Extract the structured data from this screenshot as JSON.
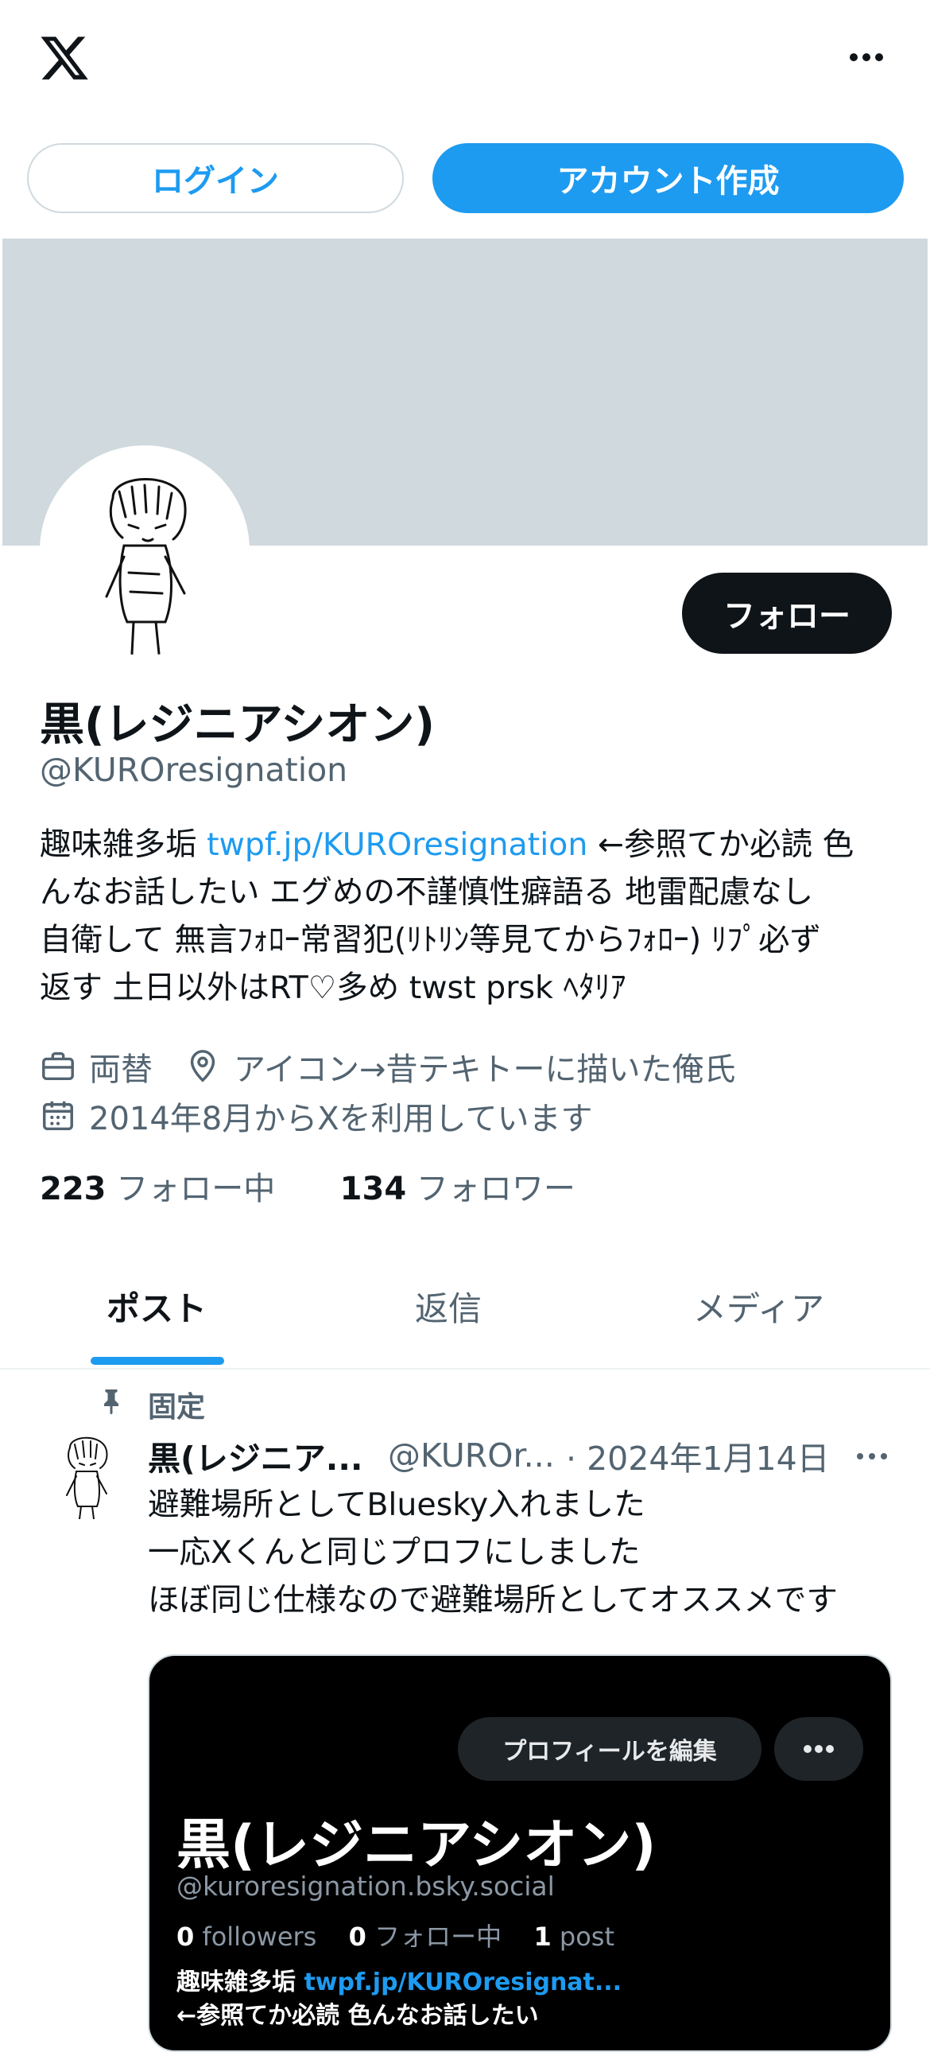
{
  "topbar": {
    "logo_icon": "x-logo-icon",
    "more_icon": "more-horizontal-icon",
    "login_label": "ログイン",
    "signup_label": "アカウント作成"
  },
  "profile": {
    "follow_label": "フォロー",
    "name": "黒(レジニアシオン)",
    "handle": "@KUROresignation",
    "bio_lines": [
      {
        "pre": "趣味雑多垢 ",
        "link": "twpf.jp/KUROresignation",
        "post": " ←参照てか必読 色"
      },
      {
        "pre": "んなお話したい エグめの不謹慎性癖語る 地雷配慮なし",
        "link": "",
        "post": ""
      },
      {
        "pre": "自衛して 無言ﾌｫﾛｰ常習犯(ﾘﾄﾘﾝ等見てからﾌｫﾛｰ) ﾘﾌﾟ必ず",
        "link": "",
        "post": ""
      },
      {
        "pre": "返す 土日以外はRT♡多め twst prsk ﾍﾀﾘｱ",
        "link": "",
        "post": ""
      }
    ],
    "category": "両替",
    "location": "アイコン→昔テキトーに描いた俺氏",
    "joined": "2014年8月からXを利用しています",
    "following_count": "223",
    "following_label": "フォロー中",
    "followers_count": "134",
    "followers_label": "フォロワー"
  },
  "tabs": [
    {
      "label": "ポスト"
    },
    {
      "label": "返信"
    },
    {
      "label": "メディア"
    }
  ],
  "post": {
    "pinned_label": "固定",
    "author": "黒(レジニア...",
    "handle": "@KUROr...",
    "date": "· 2024年1月14日",
    "lines": [
      "避難場所としてBluesky入れました",
      "一応Xくんと同じプロフにしました",
      "ほぼ同じ仕様なので避難場所としてオススメです"
    ],
    "card": {
      "edit_label": "プロフィールを編集",
      "name": "黒(レジニアシオン)",
      "handle": "@kuroresignation.bsky.social",
      "followers_count": "0",
      "followers_label": "followers",
      "following_count": "0",
      "following_label": "フォロー中",
      "posts_count": "1",
      "posts_label": "post",
      "bio_pre": "趣味雑多垢 ",
      "bio_link": "twpf.jp/KUROresignat...",
      "bio_line2": "←参照てか必読 色んなお話したい"
    }
  },
  "colors": {
    "accent": "#1d9bf0",
    "text": "#0f1419",
    "secondary": "#536471",
    "banner": "#cfd9de"
  }
}
